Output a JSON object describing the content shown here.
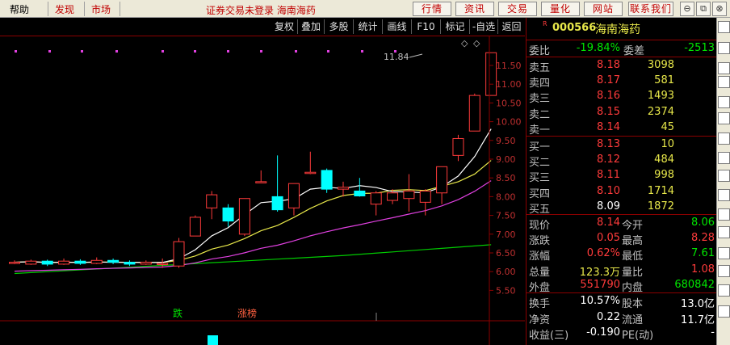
{
  "menu": {
    "items": [
      "帮助",
      "发现",
      "市场"
    ],
    "title": "证券交易未登录  海南海药",
    "buttons": [
      "行情",
      "资讯",
      "交易",
      "量化",
      "网站",
      "联系我们"
    ]
  },
  "toolbar": {
    "buttons": [
      "复权",
      "叠加",
      "多股",
      "统计",
      "画线",
      "F10",
      "标记",
      "-自选",
      "返回"
    ]
  },
  "chart": {
    "price_axis": [
      "11.50",
      "11.00",
      "10.50",
      "10.00",
      "9.50",
      "9.00",
      "8.50",
      "8.00",
      "7.50",
      "7.00",
      "6.50",
      "6.00",
      "5.50"
    ],
    "peak_label": "11.84",
    "tags": {
      "die": "跌",
      "zhangbang": "涨榜"
    },
    "colors": {
      "up": "#ff3b3b",
      "down": "#00ffff",
      "ma5": "#ffffff",
      "ma10": "#e8e84a",
      "ma20": "#e040e0",
      "ma60": "#00cc00"
    },
    "candles": [
      {
        "o": 6.25,
        "c": 6.25,
        "h": 6.3,
        "l": 6.2
      },
      {
        "o": 6.2,
        "c": 6.28,
        "h": 6.32,
        "l": 6.18
      },
      {
        "o": 6.28,
        "c": 6.2,
        "h": 6.32,
        "l": 6.15
      },
      {
        "o": 6.2,
        "c": 6.28,
        "h": 6.35,
        "l": 6.18
      },
      {
        "o": 6.28,
        "c": 6.22,
        "h": 6.33,
        "l": 6.18
      },
      {
        "o": 6.22,
        "c": 6.3,
        "h": 6.38,
        "l": 6.2
      },
      {
        "o": 6.3,
        "c": 6.25,
        "h": 6.35,
        "l": 6.2
      },
      {
        "o": 6.25,
        "c": 6.2,
        "h": 6.3,
        "l": 6.15
      },
      {
        "o": 6.2,
        "c": 6.25,
        "h": 6.3,
        "l": 6.18
      },
      {
        "o": 6.2,
        "c": 6.22,
        "h": 6.35,
        "l": 6.1
      },
      {
        "o": 6.15,
        "c": 6.8,
        "h": 6.9,
        "l": 6.1
      },
      {
        "o": 6.95,
        "c": 7.45,
        "h": 7.5,
        "l": 6.95
      },
      {
        "o": 7.7,
        "c": 8.05,
        "h": 8.15,
        "l": 7.4
      },
      {
        "o": 7.7,
        "c": 7.35,
        "h": 7.8,
        "l": 7.2
      },
      {
        "o": 7.0,
        "c": 7.95,
        "h": 7.95,
        "l": 6.95
      },
      {
        "o": 8.4,
        "c": 8.4,
        "h": 8.7,
        "l": 8.4
      },
      {
        "o": 8.0,
        "c": 7.65,
        "h": 9.1,
        "l": 7.6
      },
      {
        "o": 7.7,
        "c": 8.35,
        "h": 8.35,
        "l": 7.5
      },
      {
        "o": 8.65,
        "c": 8.65,
        "h": 9.2,
        "l": 8.6
      },
      {
        "o": 8.7,
        "c": 8.2,
        "h": 8.75,
        "l": 8.1
      },
      {
        "o": 8.2,
        "c": 8.25,
        "h": 8.4,
        "l": 8.0
      },
      {
        "o": 8.15,
        "c": 8.02,
        "h": 8.5,
        "l": 8.0
      },
      {
        "o": 7.8,
        "c": 8.1,
        "h": 8.15,
        "l": 7.5
      },
      {
        "o": 7.9,
        "c": 8.1,
        "h": 8.2,
        "l": 7.8
      },
      {
        "o": 7.95,
        "c": 8.15,
        "h": 8.6,
        "l": 7.6
      },
      {
        "o": 7.85,
        "c": 8.15,
        "h": 8.2,
        "l": 7.5
      },
      {
        "o": 8.1,
        "c": 8.8,
        "h": 8.8,
        "l": 7.8
      },
      {
        "o": 9.1,
        "c": 9.55,
        "h": 9.65,
        "l": 8.95
      },
      {
        "o": 9.75,
        "c": 10.7,
        "h": 10.75,
        "l": 9.75
      },
      {
        "o": 10.7,
        "c": 11.84,
        "h": 11.84,
        "l": 10.7
      }
    ]
  },
  "quote": {
    "code": "000566",
    "name": "海南海药",
    "weibi_label": "委比",
    "weibi": "-19.84%",
    "weicha_label": "委差",
    "weicha": "-2513",
    "sells": [
      {
        "label": "卖五",
        "price": "8.18",
        "vol": "3098"
      },
      {
        "label": "卖四",
        "price": "8.17",
        "vol": "581"
      },
      {
        "label": "卖三",
        "price": "8.16",
        "vol": "1493"
      },
      {
        "label": "卖二",
        "price": "8.15",
        "vol": "2374"
      },
      {
        "label": "卖一",
        "price": "8.14",
        "vol": "45"
      }
    ],
    "buys": [
      {
        "label": "买一",
        "price": "8.13",
        "vol": "10"
      },
      {
        "label": "买二",
        "price": "8.12",
        "vol": "484"
      },
      {
        "label": "买三",
        "price": "8.11",
        "vol": "998"
      },
      {
        "label": "买四",
        "price": "8.10",
        "vol": "1714"
      },
      {
        "label": "买五",
        "price": "8.09",
        "vol": "1872"
      }
    ],
    "stats": [
      {
        "l1": "现价",
        "v1": "8.14",
        "c1": "red",
        "l2": "今开",
        "v2": "8.06",
        "c2": "grn"
      },
      {
        "l1": "涨跌",
        "v1": "0.05",
        "c1": "red",
        "l2": "最高",
        "v2": "8.28",
        "c2": "red"
      },
      {
        "l1": "涨幅",
        "v1": "0.62%",
        "c1": "red",
        "l2": "最低",
        "v2": "7.61",
        "c2": "grn"
      },
      {
        "l1": "总量",
        "v1": "123.3万",
        "c1": "yel",
        "l2": "量比",
        "v2": "1.08",
        "c2": "red"
      },
      {
        "l1": "外盘",
        "v1": "551790",
        "c1": "red",
        "l2": "内盘",
        "v2": "680842",
        "c2": "grn"
      }
    ],
    "stats2": [
      {
        "l1": "换手",
        "v1": "10.57%",
        "l2": "股本",
        "v2": "13.0亿"
      },
      {
        "l1": "净资",
        "v1": "0.22",
        "l2": "流通",
        "v2": "11.7亿"
      },
      {
        "l1": "收益(三)",
        "v1": "-0.190",
        "l2": "PE(动)",
        "v2": "-"
      }
    ]
  }
}
